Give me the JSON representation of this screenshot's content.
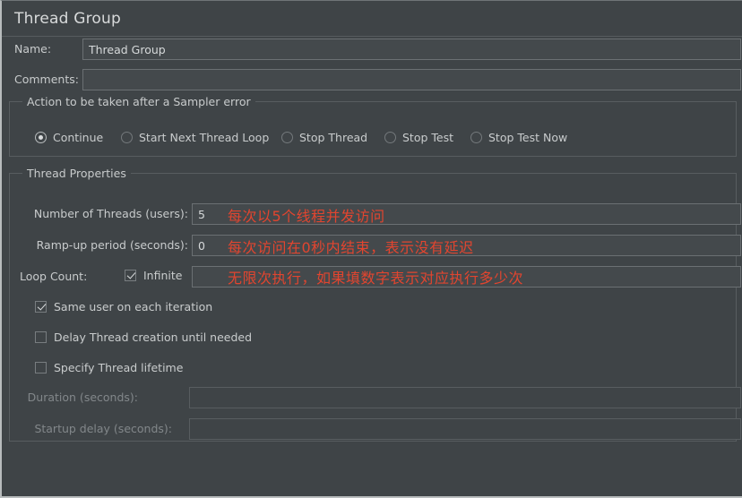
{
  "window": {
    "title": "Thread Group"
  },
  "form": {
    "name_label": "Name:",
    "name_value": "Thread Group",
    "comments_label": "Comments:",
    "comments_value": "",
    "comments_placeholder": ""
  },
  "sampler_error": {
    "group_title": "Action to be taken after a Sampler error",
    "options": [
      {
        "label": "Continue",
        "selected": true
      },
      {
        "label": "Start Next Thread Loop",
        "selected": false
      },
      {
        "label": "Stop Thread",
        "selected": false
      },
      {
        "label": "Stop Test",
        "selected": false
      },
      {
        "label": "Stop Test Now",
        "selected": false
      }
    ]
  },
  "thread_properties": {
    "group_title": "Thread Properties",
    "num_threads_label": "Number of Threads (users):",
    "num_threads_value": "5",
    "rampup_label": "Ramp-up period (seconds):",
    "rampup_value": "0",
    "loop_count_label": "Loop Count:",
    "infinite_label": "Infinite",
    "infinite_checked": true,
    "loop_count_value": "",
    "same_user_label": "Same user on each iteration",
    "same_user_checked": true,
    "delay_thread_label": "Delay Thread creation until needed",
    "delay_thread_checked": false,
    "specify_lifetime_label": "Specify Thread lifetime",
    "specify_lifetime_checked": false,
    "duration_label": "Duration (seconds):",
    "duration_value": "",
    "startup_delay_label": "Startup delay (seconds):",
    "startup_delay_value": ""
  },
  "annotations": {
    "accent_color": "#e2452f",
    "threads_note": "每次以5个线程并发访问",
    "rampup_note": "每次访问在0秒内结束，表示没有延迟",
    "loop_note": "无限次执行，如果填数字表示对应执行多少次"
  }
}
